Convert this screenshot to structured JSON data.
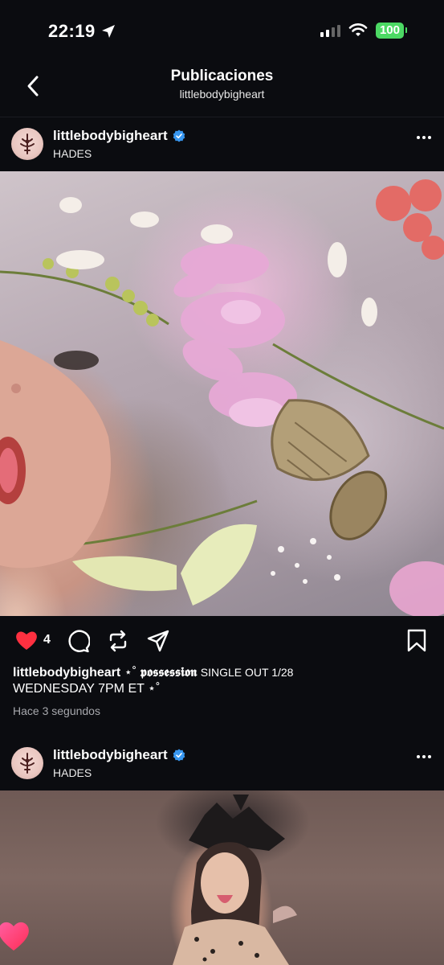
{
  "status_bar": {
    "time": "22:19",
    "battery": "100"
  },
  "nav": {
    "title": "Publicaciones",
    "subtitle": "littlebodybigheart"
  },
  "posts": [
    {
      "username": "littlebodybigheart",
      "subtitle": "HADES",
      "likes": "4",
      "caption_user": "littlebodybigheart",
      "caption_deco_start": "⋆˚",
      "caption_fancy": "𝖕𝖔𝖘𝖘𝖊𝖘𝖘𝖎𝖔𝖓",
      "caption_text": "SINGLE OUT 1/28",
      "caption_line2": "WEDNESDAY 7PM ET",
      "caption_deco_end": "⋆˚",
      "time_ago": "Hace 3 segundos"
    },
    {
      "username": "littlebodybigheart",
      "subtitle": "HADES"
    }
  ],
  "colors": {
    "background": "#0b0c10",
    "like": "#ff3040",
    "verified": "#3897f0",
    "battery": "#4cd964"
  },
  "icons": [
    "back-icon",
    "location-arrow-icon",
    "wifi-icon",
    "verified-icon",
    "more-icon",
    "heart-icon",
    "comment-icon",
    "repost-icon",
    "share-icon",
    "bookmark-icon"
  ]
}
